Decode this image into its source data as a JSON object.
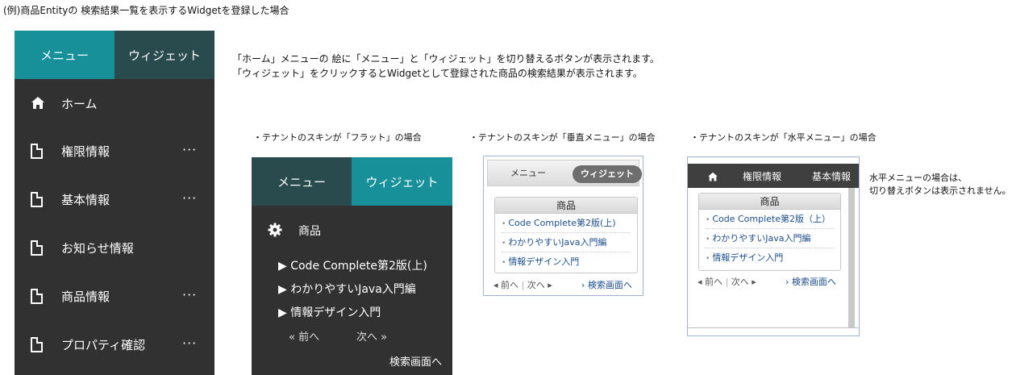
{
  "title": "(例)商品Entityの 検索結果一覧を表示するWidgetを登録した場合",
  "description": {
    "line1": "「ホーム」メニューの 絵に「メニュー」と「ウィジェット」を切り替えるボタンが表示されます。",
    "line2": "「ウィジェット」をクリックするとWidgetとして登録された商品の検索結果が表示されます。"
  },
  "main_menu": {
    "tab_menu": "メニュー",
    "tab_widget": "ウィジェット",
    "items": [
      {
        "label": "ホーム",
        "icon": "home-icon"
      },
      {
        "label": "権限情報",
        "icon": "document-icon",
        "more": "···"
      },
      {
        "label": "基本情報",
        "icon": "document-icon",
        "more": "···"
      },
      {
        "label": "お知らせ情報",
        "icon": "document-icon"
      },
      {
        "label": "商品情報",
        "icon": "document-icon",
        "more": "···"
      },
      {
        "label": "プロパティ確認",
        "icon": "document-icon",
        "more": "···"
      }
    ]
  },
  "captions": {
    "flat": "・テナントのスキンが「フラット」の場合",
    "vertical": "・テナントのスキンが「垂直メニュー」の場合",
    "horizontal": "・テナントのスキンが「水平メニュー」の場合"
  },
  "flat": {
    "tab_menu": "メニュー",
    "tab_widget": "ウィジェット",
    "widget_title": "商品",
    "items": [
      "▶ Code Complete第2版(上)",
      "▶ わかりやすいJava入門編",
      "▶ 情報デザイン入門"
    ],
    "prev": "«  前へ",
    "next": "次へ  »",
    "search_link": "検索画面へ"
  },
  "vertical": {
    "tab_menu": "メニュー",
    "tab_widget": "ウィジェット",
    "widget_title": "商品",
    "items": [
      "Code Complete第2版(上)",
      "わかりやすいJava入門編",
      "情報デザイン入門"
    ],
    "prev": "◂ 前へ",
    "sep": "|",
    "next": "次へ ▸",
    "search_link": "› 検索画面へ"
  },
  "horizontal": {
    "menu_items": [
      "権限情報",
      "基本情報"
    ],
    "widget_title": "商品",
    "items": [
      "Code Complete第2版（上）",
      "わかりやすいJava入門編",
      "情報デザイン入門"
    ],
    "prev": "◂ 前へ",
    "sep": "|",
    "next": "次へ ▸",
    "search_link": "› 検索画面へ"
  },
  "note": {
    "line1": "水平メニューの場合は、",
    "line2": "切り替えボタンは表示されません。"
  },
  "colors": {
    "teal": "#17909a",
    "dark_teal": "#2a4b4e",
    "dark_bg": "#313131",
    "link_blue": "#1d4f8c"
  }
}
